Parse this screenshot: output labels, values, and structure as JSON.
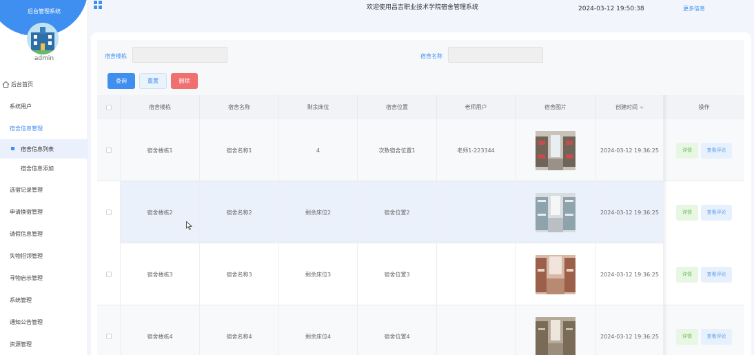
{
  "sidebar": {
    "brand_title": "后台管理系统",
    "username": "admin",
    "menu": [
      {
        "label": "后台首页",
        "icon": "home-icon"
      },
      {
        "label": "系统用户"
      },
      {
        "label": "宿舍信息管理"
      },
      {
        "label": "宿舍信息列表"
      },
      {
        "label": "宿舍信息添加"
      },
      {
        "label": "选宿记录管理"
      },
      {
        "label": "申请换宿管理"
      },
      {
        "label": "请假信息管理"
      },
      {
        "label": "失物招领管理"
      },
      {
        "label": "寻物启示管理"
      },
      {
        "label": "系统管理"
      },
      {
        "label": "通知公告管理"
      },
      {
        "label": "资源管理"
      }
    ]
  },
  "header": {
    "welcome": "欢迎使用昌吉职业技术学院宿舍管理系统",
    "datetime": "2024-03-12 19:50:38",
    "more_info": "更多信息"
  },
  "search": {
    "building_label": "宿舍楼栋",
    "building_value": "",
    "name_label": "宿舍名称",
    "name_value": "",
    "query": "查询",
    "reset": "重置",
    "delete": "删除"
  },
  "table": {
    "headers": [
      "宿舍楼栋",
      "宿舍名称",
      "剩余床位",
      "宿舍位置",
      "老师用户",
      "宿舍图片",
      "创建时间",
      "操作"
    ],
    "rows": [
      {
        "building": "宿舍楼栋1",
        "name": "宿舍名称1",
        "beds": "4",
        "location": "次数宿舍位置1",
        "teacher": "老师1-223344",
        "created": "2024-03-12 19:36:25"
      },
      {
        "building": "宿舍楼栋2",
        "name": "宿舍名称2",
        "beds": "剩余床位2",
        "location": "宿舍位置2",
        "teacher": "",
        "created": "2024-03-12 19:36:25"
      },
      {
        "building": "宿舍楼栋3",
        "name": "宿舍名称3",
        "beds": "剩余床位3",
        "location": "宿舍位置3",
        "teacher": "",
        "created": "2024-03-12 19:36:25"
      },
      {
        "building": "宿舍楼栋4",
        "name": "宿舍名称4",
        "beds": "剩余床位4",
        "location": "宿舍位置4",
        "teacher": "",
        "created": "2024-03-12 19:36:25"
      }
    ],
    "action_detail": "详情",
    "action_comment": "查看评论"
  }
}
